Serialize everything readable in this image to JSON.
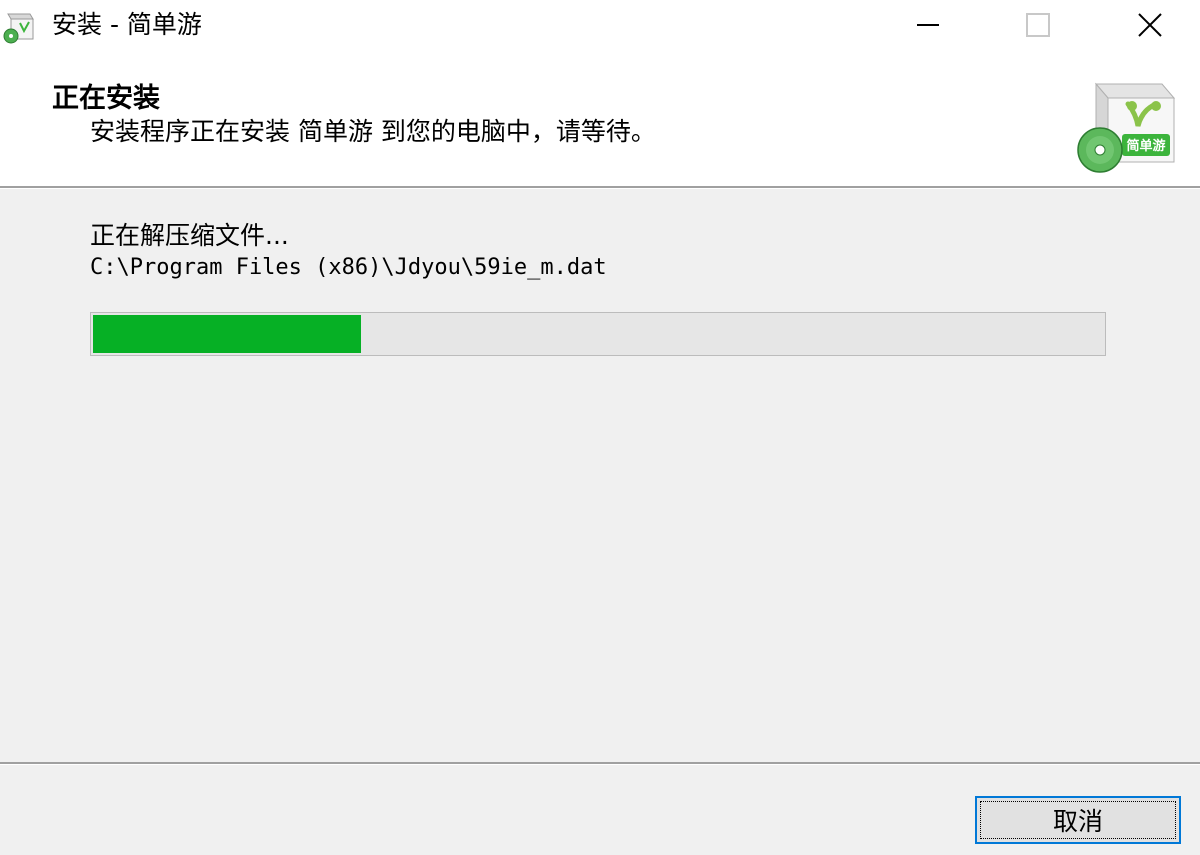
{
  "window": {
    "title": "安装 - 简单游"
  },
  "header": {
    "title": "正在安装",
    "subtitle": "安装程序正在安装 简单游 到您的电脑中，请等待。",
    "logo_text": "简单游"
  },
  "main": {
    "status": "正在解压缩文件...",
    "current_file": "C:\\Program Files (x86)\\Jdyou\\59ie_m.dat",
    "progress_fraction": 0.265
  },
  "footer": {
    "cancel_label": "取消"
  },
  "colors": {
    "progress": "#06b025",
    "brand_green": "#3cb43c",
    "focus_border": "#0078d7"
  },
  "icons": {
    "app": "installer-box-icon",
    "minimize": "minimize-icon",
    "maximize": "maximize-icon",
    "close": "close-icon"
  }
}
